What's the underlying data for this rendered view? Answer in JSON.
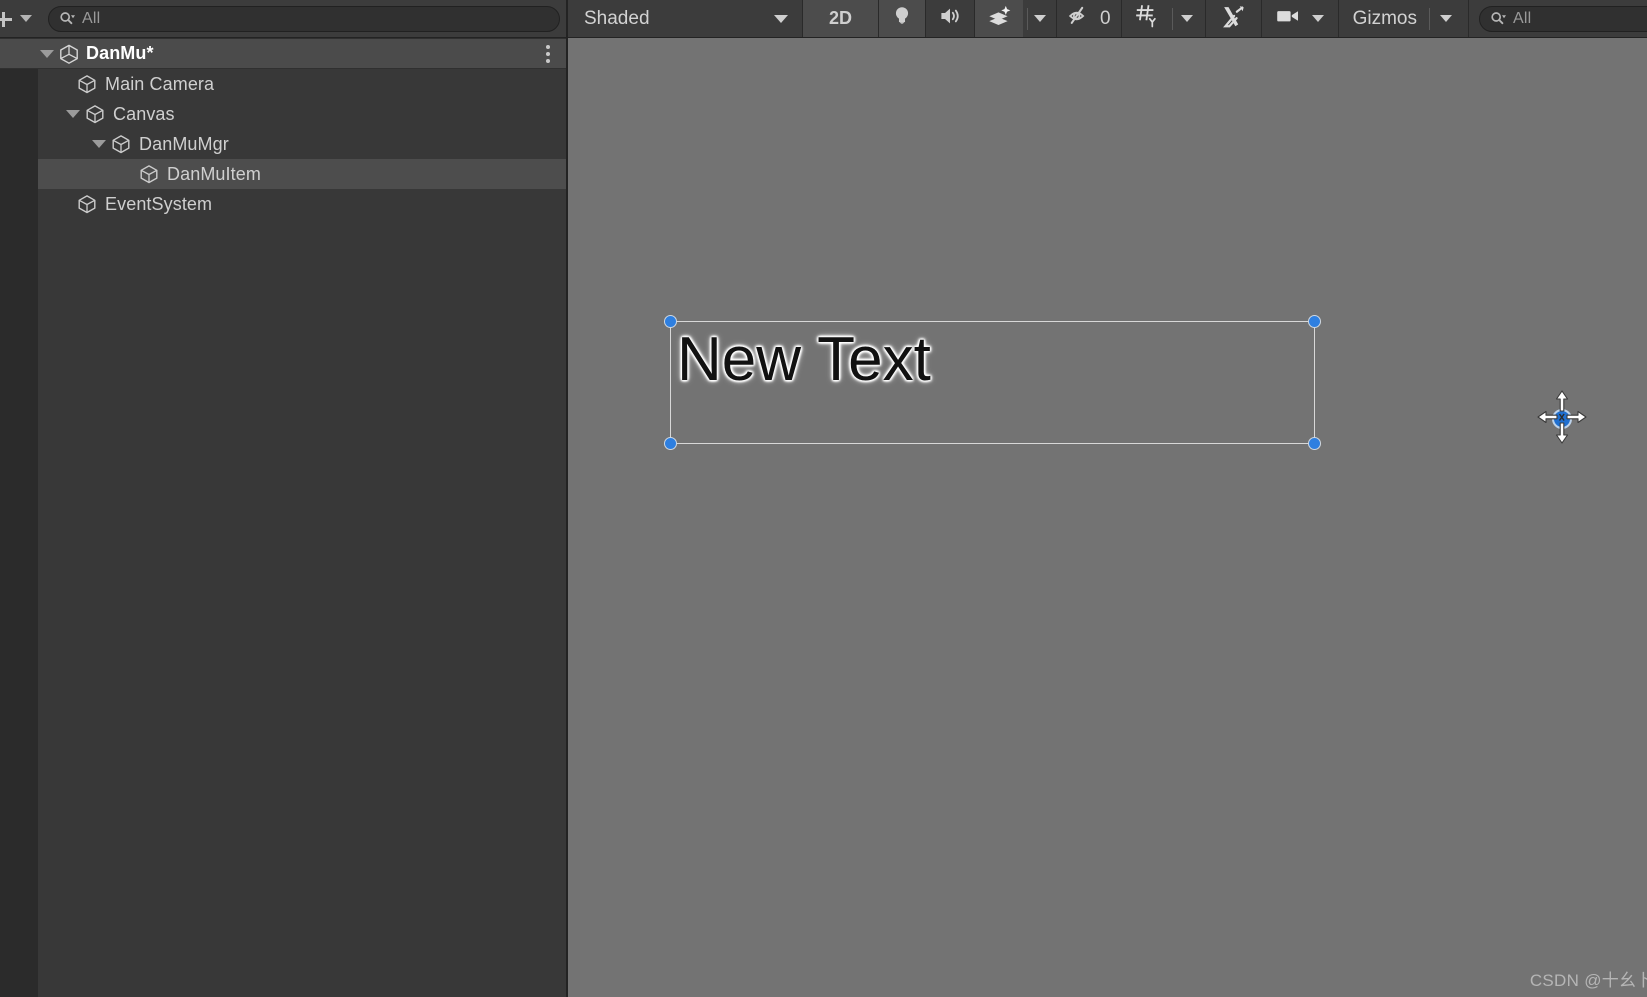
{
  "hierarchy": {
    "toolbar": {
      "create_label": "+",
      "create_icon": "plus-icon",
      "dropdown_icon": "chevron-down-icon",
      "search_icon": "search-icon",
      "search_value": "",
      "search_placeholder": "All"
    },
    "tree": [
      {
        "label": "DanMu*",
        "icon": "unity-scene-icon",
        "depth": 0,
        "expanded": true,
        "selected": false,
        "is_scene": true,
        "has_menu": true
      },
      {
        "label": "Main Camera",
        "icon": "gameobject-cube-icon",
        "depth": 1,
        "expanded": null,
        "selected": false,
        "is_scene": false,
        "has_menu": false
      },
      {
        "label": "Canvas",
        "icon": "gameobject-cube-icon",
        "depth": 1,
        "expanded": true,
        "selected": false,
        "is_scene": false,
        "has_menu": false
      },
      {
        "label": "DanMuMgr",
        "icon": "gameobject-cube-icon",
        "depth": 2,
        "expanded": true,
        "selected": false,
        "is_scene": false,
        "has_menu": false
      },
      {
        "label": "DanMuItem",
        "icon": "gameobject-cube-icon",
        "depth": 3,
        "expanded": null,
        "selected": true,
        "is_scene": false,
        "has_menu": false
      },
      {
        "label": "EventSystem",
        "icon": "gameobject-cube-icon",
        "depth": 1,
        "expanded": null,
        "selected": false,
        "is_scene": false,
        "has_menu": false
      }
    ]
  },
  "scene": {
    "toolbar": {
      "draw_mode_label": "Shaded",
      "draw_mode_caret": "chevron-down-icon",
      "two_d_label": "2D",
      "lighting_icon": "lightbulb-icon",
      "audio_icon": "speaker-icon",
      "effects_icon": "fx-layers-icon",
      "effects_caret": "chevron-down-icon",
      "hidden_objects_icon": "eye-slash-icon",
      "hidden_objects_count": "0",
      "grid_icon": "grid-axis-icon",
      "grid_caret": "chevron-down-icon",
      "tools_icon": "tools-icon",
      "camera_icon": "scene-camera-icon",
      "camera_caret": "chevron-down-icon",
      "gizmos_label": "Gizmos",
      "gizmos_caret": "chevron-down-icon",
      "search_icon": "search-icon",
      "search_value": "",
      "search_placeholder": "All"
    },
    "selected_object": {
      "text": "New Text",
      "handle_color": "#2e7fe0",
      "outline_color": "#d8d8d8",
      "cursor": "move-cursor",
      "pivot_icon": "pivot-handle-icon"
    },
    "background_color": "#737373"
  },
  "watermark": "CSDN @十幺卜入"
}
